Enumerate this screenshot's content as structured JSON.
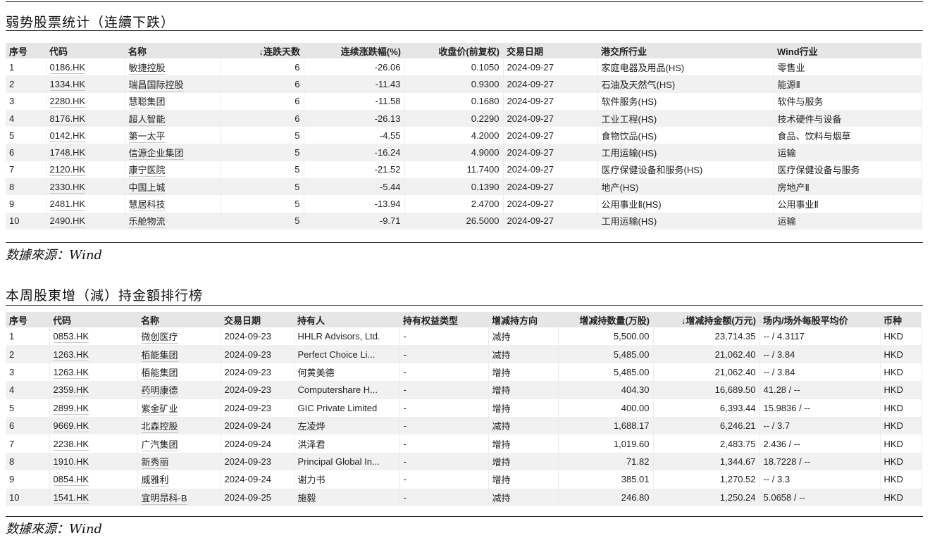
{
  "section1": {
    "title": "弱势股票统计（连續下跌）",
    "headers": [
      "序号",
      "代码",
      "名称",
      "↓连跌天数",
      "连续涨跌幅(%)",
      "收盘价(前复权)",
      "交易日期",
      "港交所行业",
      "Wind行业"
    ],
    "rows": [
      [
        "1",
        "0186.HK",
        "敏捷控股",
        "6",
        "-26.06",
        "0.1050",
        "2024-09-27",
        "家庭电器及用品(HS)",
        "零售业"
      ],
      [
        "2",
        "1334.HK",
        "瑞昌国际控股",
        "6",
        "-11.43",
        "0.9300",
        "2024-09-27",
        "石油及天然气(HS)",
        "能源Ⅱ"
      ],
      [
        "3",
        "2280.HK",
        "慧聪集团",
        "6",
        "-11.58",
        "0.1680",
        "2024-09-27",
        "软件服务(HS)",
        "软件与服务"
      ],
      [
        "4",
        "8176.HK",
        "超人智能",
        "6",
        "-26.13",
        "0.2290",
        "2024-09-27",
        "工业工程(HS)",
        "技术硬件与设备"
      ],
      [
        "5",
        "0142.HK",
        "第一太平",
        "5",
        "-4.55",
        "4.2000",
        "2024-09-27",
        "食物饮品(HS)",
        "食品、饮料与烟草"
      ],
      [
        "6",
        "1748.HK",
        "信源企业集团",
        "5",
        "-16.24",
        "4.9000",
        "2024-09-27",
        "工用运输(HS)",
        "运输"
      ],
      [
        "7",
        "2120.HK",
        "康宁医院",
        "5",
        "-21.52",
        "11.7400",
        "2024-09-27",
        "医疗保健设备和服务(HS)",
        "医疗保健设备与服务"
      ],
      [
        "8",
        "2330.HK",
        "中国上城",
        "5",
        "-5.44",
        "0.1390",
        "2024-09-27",
        "地产(HS)",
        "房地产Ⅱ"
      ],
      [
        "9",
        "2481.HK",
        "慧居科技",
        "5",
        "-13.94",
        "2.4700",
        "2024-09-27",
        "公用事业Ⅱ(HS)",
        "公用事业Ⅱ"
      ],
      [
        "10",
        "2490.HK",
        "乐舱物流",
        "5",
        "-9.71",
        "26.5000",
        "2024-09-27",
        "工用运输(HS)",
        "运输"
      ]
    ],
    "source": "数據來源：Wind"
  },
  "section2": {
    "title": "本周股東增（減）持金額排行榜",
    "headers": [
      "序号",
      "代码",
      "名称",
      "交易日期",
      "持有人",
      "持有权益类型",
      "增减持方向",
      "增减持数量(万股)",
      "↓增减持金额(万元)",
      "场内/场外每股平均价",
      "币种"
    ],
    "rows": [
      [
        "1",
        "0853.HK",
        "微创医疗",
        "2024-09-23",
        "HHLR Advisors, Ltd.",
        "-",
        "减持",
        "5,500.00",
        "23,714.35",
        "-- / 4.3117",
        "HKD"
      ],
      [
        "2",
        "1263.HK",
        "栢能集团",
        "2024-09-23",
        "Perfect Choice Li...",
        "-",
        "减持",
        "5,485.00",
        "21,062.40",
        "-- / 3.84",
        "HKD"
      ],
      [
        "3",
        "1263.HK",
        "栢能集团",
        "2024-09-23",
        "何黄美德",
        "-",
        "增持",
        "5,485.00",
        "21,062.40",
        "-- / 3.84",
        "HKD"
      ],
      [
        "4",
        "2359.HK",
        "药明康德",
        "2024-09-23",
        "Computershare H...",
        "-",
        "增持",
        "404.30",
        "16,689.50",
        "41.28 / --",
        "HKD"
      ],
      [
        "5",
        "2899.HK",
        "紫金矿业",
        "2024-09-23",
        "GIC Private Limited",
        "-",
        "增持",
        "400.00",
        "6,393.44",
        "15.9836 / --",
        "HKD"
      ],
      [
        "6",
        "9669.HK",
        "北森控股",
        "2024-09-24",
        "左凌烨",
        "-",
        "减持",
        "1,688.17",
        "6,246.21",
        "-- / 3.7",
        "HKD"
      ],
      [
        "7",
        "2238.HK",
        "广汽集团",
        "2024-09-24",
        "洪泽君",
        "-",
        "增持",
        "1,019.60",
        "2,483.75",
        "2.436 / --",
        "HKD"
      ],
      [
        "8",
        "1910.HK",
        "新秀丽",
        "2024-09-23",
        "Principal Global In...",
        "-",
        "增持",
        "71.82",
        "1,344.67",
        "18.7228 / --",
        "HKD"
      ],
      [
        "9",
        "0854.HK",
        "威雅利",
        "2024-09-24",
        "谢力书",
        "-",
        "增持",
        "385.01",
        "1,270.52",
        "-- / 3.3",
        "HKD"
      ],
      [
        "10",
        "1541.HK",
        "宜明昂科-B",
        "2024-09-25",
        "施毅",
        "-",
        "减持",
        "246.80",
        "1,250.24",
        "5.0658 / --",
        "HKD"
      ]
    ],
    "source": "数據來源：Wind"
  }
}
